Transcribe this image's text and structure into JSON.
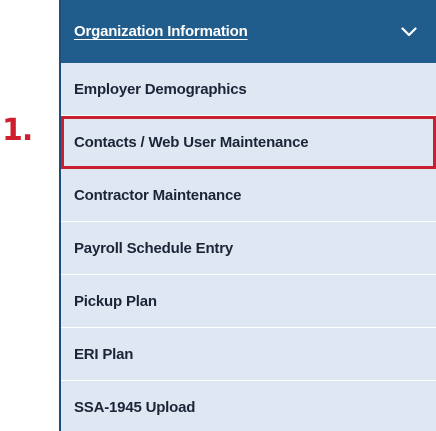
{
  "callout": {
    "label": "1."
  },
  "menu": {
    "header": {
      "title": "Organization Information",
      "expanded_icon": "chevron-down-icon"
    },
    "items": [
      {
        "label": "Employer Demographics",
        "highlighted": false
      },
      {
        "label": "Contacts / Web User Maintenance",
        "highlighted": true
      },
      {
        "label": "Contractor Maintenance",
        "highlighted": false
      },
      {
        "label": "Payroll Schedule Entry",
        "highlighted": false
      },
      {
        "label": "Pickup Plan",
        "highlighted": false
      },
      {
        "label": "ERI Plan",
        "highlighted": false
      },
      {
        "label": "SSA-1945 Upload",
        "highlighted": false
      }
    ]
  },
  "colors": {
    "header_bg": "#205c8c",
    "menu_bg": "#dfe7f3",
    "highlight": "#c8202f",
    "callout": "#cf1f2e"
  }
}
